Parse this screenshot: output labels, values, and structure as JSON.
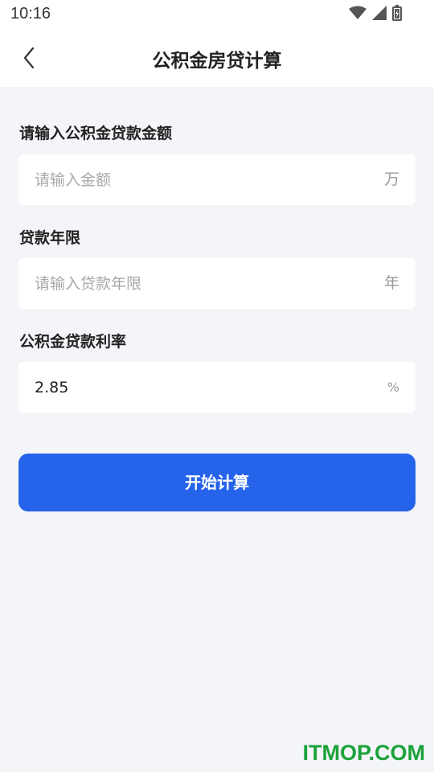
{
  "status_bar": {
    "time": "10:16",
    "icons": [
      "wifi-icon",
      "signal-icon",
      "battery-icon"
    ]
  },
  "nav": {
    "title": "公积金房贷计算",
    "back_icon": "chevron-left-icon"
  },
  "form": {
    "amount": {
      "label": "请输入公积金贷款金额",
      "placeholder": "请输入金额",
      "value": "",
      "unit": "万"
    },
    "term": {
      "label": "贷款年限",
      "placeholder": "请输入贷款年限",
      "value": "",
      "unit": "年"
    },
    "rate": {
      "label": "公积金贷款利率",
      "placeholder": "",
      "value": "2.85",
      "unit": "%"
    }
  },
  "actions": {
    "calculate_label": "开始计算"
  },
  "watermark": "ITMOP.COM",
  "colors": {
    "primary": "#2563EB",
    "background": "#F4F5F9",
    "watermark": "#1BA23A"
  }
}
